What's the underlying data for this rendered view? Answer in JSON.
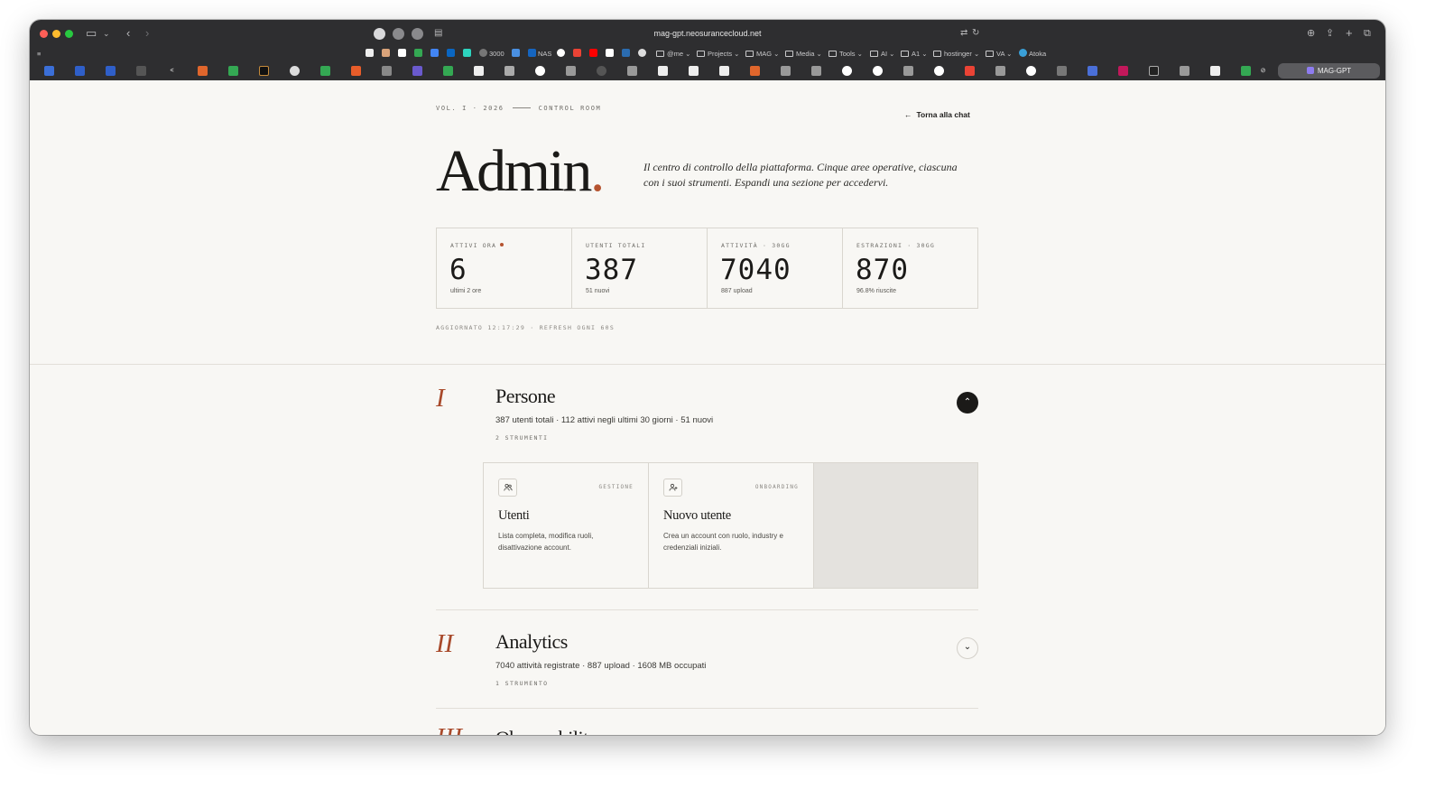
{
  "browser": {
    "url": "mag-gpt.neosurancecloud.net",
    "favorites": [
      "3000",
      "NAS",
      "@me",
      "Projects",
      "MAG",
      "Media",
      "Tools",
      "AI",
      "A1",
      "hostinger",
      "VA",
      "Atoka"
    ],
    "active_tab": "MAG-GPT"
  },
  "header": {
    "kicker_left": "VOL. I · 2026",
    "kicker_right": "CONTROL ROOM",
    "back_label": "Torna alla chat",
    "title": "Admin",
    "title_dot": ".",
    "lede": "Il centro di controllo della piattaforma. Cinque aree operative, ciascuna con i suoi strumenti. Espandi una sezione per accedervi."
  },
  "stats": [
    {
      "label": "ATTIVI ORA",
      "value": "6",
      "sub": "ultimi 2 ore"
    },
    {
      "label": "UTENTI TOTALI",
      "value": "387",
      "sub": "51 nuovi"
    },
    {
      "label": "ATTIVITÀ · 30GG",
      "value": "7040",
      "sub": "887 upload"
    },
    {
      "label": "ESTRAZIONI · 30GG",
      "value": "870",
      "sub": "96.8% riuscite"
    }
  ],
  "updated": "AGGIORNATO 12:17:29 · REFRESH OGNI 60S",
  "sections": [
    {
      "numeral": "I",
      "title": "Persone",
      "desc": "387 utenti totali · 112 attivi negli ultimi 30 giorni · 51 nuovi",
      "count": "2 STRUMENTI",
      "toggle": "⌃",
      "tools": [
        {
          "tag": "GESTIONE",
          "name": "Utenti",
          "desc": "Lista completa, modifica ruoli, disattivazione account.",
          "icon": "users-icon"
        },
        {
          "tag": "ONBOARDING",
          "name": "Nuovo utente",
          "desc": "Crea un account con ruolo, industry e credenziali iniziali.",
          "icon": "user-plus-icon"
        }
      ]
    },
    {
      "numeral": "II",
      "title": "Analytics",
      "desc": "7040 attività registrate · 887 upload · 1608 MB occupati",
      "count": "1 STRUMENTO",
      "toggle": "⌄"
    },
    {
      "numeral": "III",
      "title": "Observability"
    }
  ]
}
